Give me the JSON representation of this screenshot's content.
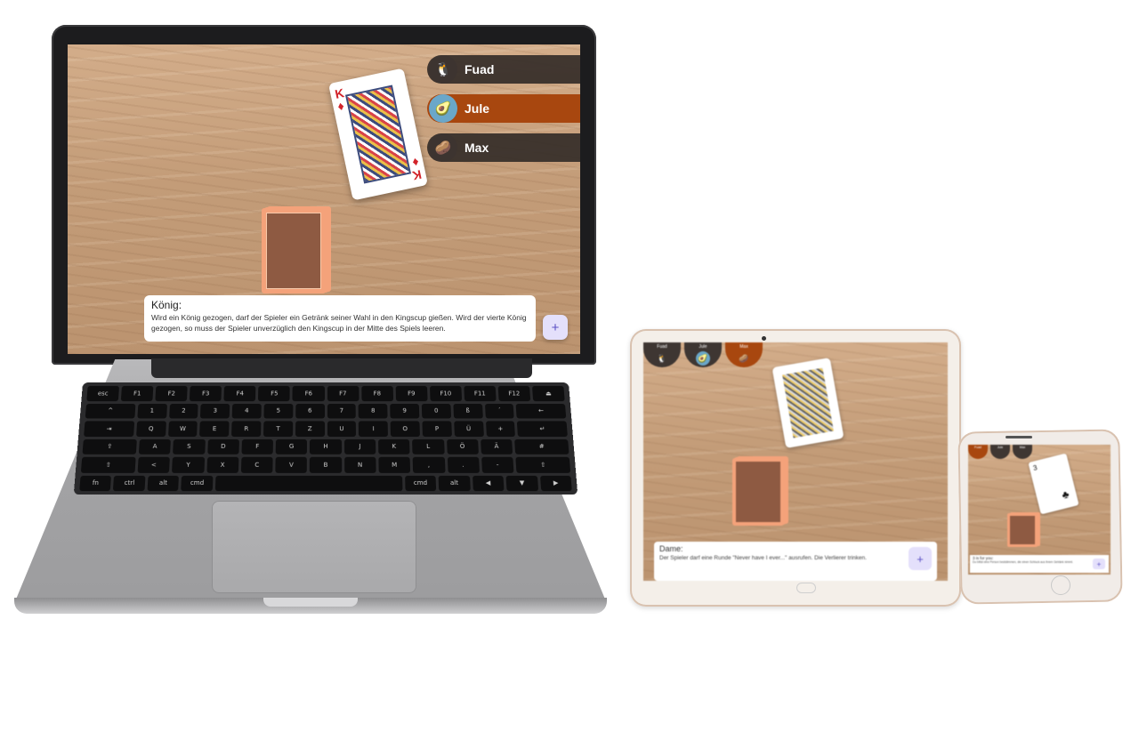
{
  "laptop": {
    "players": [
      {
        "name": "Fuad",
        "avatar": "🐧",
        "avatar_icon": "penguin-icon",
        "active": false
      },
      {
        "name": "Jule",
        "avatar": "🥑",
        "avatar_icon": "avocado-icon",
        "active": true
      },
      {
        "name": "Max",
        "avatar": "🥔",
        "avatar_icon": "potato-icon",
        "active": false
      }
    ],
    "drawn_card": {
      "rank": "K",
      "suit": "♦",
      "suit_icon": "diamond-icon"
    },
    "info": {
      "title": "König:",
      "text": "Wird ein König gezogen, darf der Spieler ein Getränk seiner Wahl in den Kingscup gießen. Wird der vierte König gezogen, so muss der Spieler unverzüglich den Kingscup in der Mitte des Spiels leeren."
    },
    "fab_label": "+"
  },
  "keyboard_rows": [
    [
      "esc",
      "F1",
      "F2",
      "F3",
      "F4",
      "F5",
      "F6",
      "F7",
      "F8",
      "F9",
      "F10",
      "F11",
      "F12",
      "⏏"
    ],
    [
      "^",
      "1",
      "2",
      "3",
      "4",
      "5",
      "6",
      "7",
      "8",
      "9",
      "0",
      "ß",
      "´",
      "←"
    ],
    [
      "⇥",
      "Q",
      "W",
      "E",
      "R",
      "T",
      "Z",
      "U",
      "I",
      "O",
      "P",
      "Ü",
      "+",
      "↵"
    ],
    [
      "⇪",
      "A",
      "S",
      "D",
      "F",
      "G",
      "H",
      "J",
      "K",
      "L",
      "Ö",
      "Ä",
      "#"
    ],
    [
      "⇧",
      "<",
      "Y",
      "X",
      "C",
      "V",
      "B",
      "N",
      "M",
      ",",
      ".",
      "-",
      "⇧"
    ],
    [
      "fn",
      "ctrl",
      "alt",
      "cmd",
      "",
      "cmd",
      "alt",
      "◀",
      "▼",
      "▶"
    ]
  ],
  "tablet": {
    "players": [
      "Fuad",
      "Jule",
      "Max"
    ],
    "active_index": 2,
    "info": {
      "title": "Dame:",
      "text": "Der Spieler darf eine Runde \"Never have I ever...\" ausrufen. Die Verlierer trinken."
    },
    "fab_label": "+"
  },
  "phone": {
    "players": [
      "Fuad",
      "Jule",
      "Max"
    ],
    "active_index": 0,
    "card": {
      "rank": "3",
      "suit": "♣"
    },
    "info": {
      "title": "3 is for you:",
      "text": "Du bittst eine Person beststimmen, die einen Schluck aus ihrem Getränk nimmt."
    },
    "fab_label": "+"
  },
  "colors": {
    "active_player": "#a8470f",
    "inactive_player": "#342c28",
    "fab_bg": "#e4e0fb",
    "card_back": "#f4a27a"
  }
}
